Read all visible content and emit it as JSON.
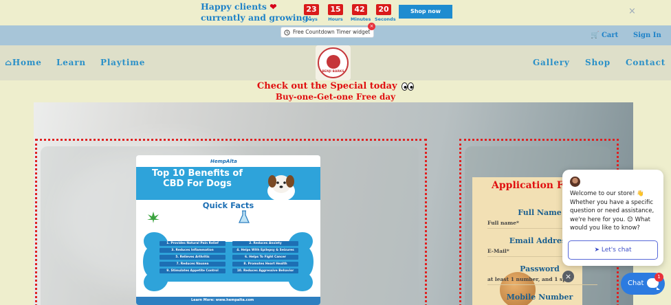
{
  "countdown": {
    "headline_line1": "Happy clients",
    "headline_line2": "currently and growing:",
    "heart_icon": "heart-icon",
    "units": [
      {
        "value": "23",
        "label": "Days"
      },
      {
        "value": "15",
        "label": "Hours"
      },
      {
        "value": "42",
        "label": "Minutes"
      },
      {
        "value": "20",
        "label": "Seconds"
      }
    ],
    "cta_label": "Shop now",
    "close_label": "×",
    "accent_color": "#d91a1a",
    "text_color": "#1e82c8"
  },
  "widget_badge": {
    "label": "Free Countdown Timer widget",
    "close_label": "×"
  },
  "account": {
    "cart_label": "Cart",
    "signin_label": "Sign In"
  },
  "nav": {
    "home_label": "Home",
    "learn_label": "Learn",
    "playtime_label": "Playtime",
    "gallery_label": "Gallery",
    "shop_label": "Shop",
    "contact_label": "Contact",
    "logo_text": "BENJI BARKS"
  },
  "promo": {
    "line1": "Check out the Special today",
    "line2": "Buy-one-Get-one Free day",
    "eyes_icon": "eyes-icon"
  },
  "infographic": {
    "brand": "HempAlta",
    "title": "Top 10 Benefits of CBD For Dogs",
    "subtitle": "Quick Facts",
    "benefits": [
      "1. Provides Natural Pain Relief",
      "2. Reduces Anxiety",
      "3. Reduces Inflammation",
      "4. Helps With Epilepsy & Seizures",
      "5. Relieves Arthritis",
      "6. Helps To Fight Cancer",
      "7. Reduces Nausea",
      "8. Promotes Heart Health",
      "9. Stimulates Appetite Control",
      "10. Reduces Aggressive Behavior"
    ],
    "footer_text": "Learn More: www.hempalta.com"
  },
  "form": {
    "title": "Application Form",
    "fields": [
      {
        "label": "Full Name",
        "placeholder": "Full name*"
      },
      {
        "label": "Email Address",
        "placeholder": "E-Mail*"
      },
      {
        "label": "Password",
        "placeholder": "at least 1 number, and 1 sp"
      },
      {
        "label": "Mobile Number",
        "placeholder": ""
      }
    ]
  },
  "chat": {
    "message": "Welcome to our store! 👋 Whether you have a specific question or need assistance, we're here for you. 😊 What would you like to know?",
    "cta_label": "Let's chat",
    "launcher_label": "Chat",
    "badge_count": "1",
    "close_label": "×",
    "accent_color": "#2c7be0"
  }
}
